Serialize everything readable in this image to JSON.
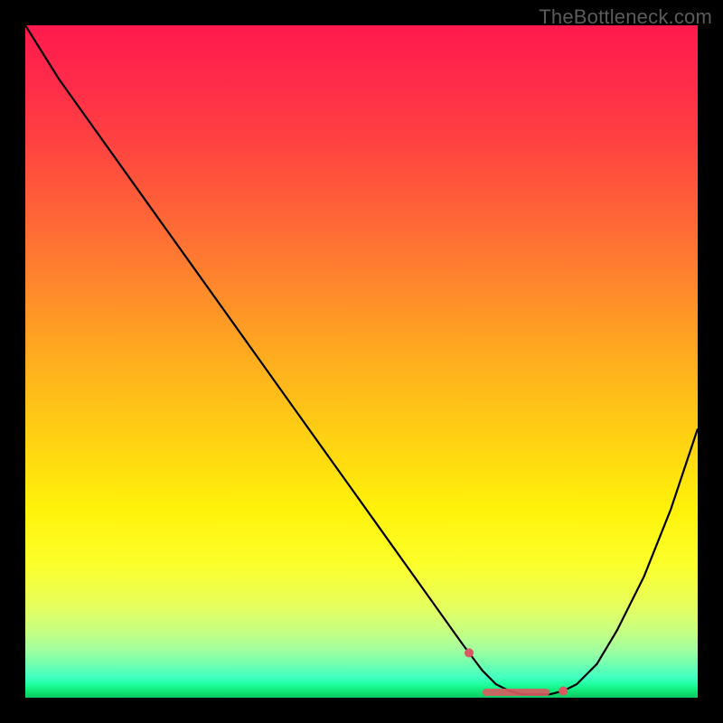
{
  "watermark": "TheBottleneck.com",
  "chart_data": {
    "type": "line",
    "x": [
      0.0,
      0.05,
      0.1,
      0.15,
      0.2,
      0.25,
      0.3,
      0.35,
      0.4,
      0.45,
      0.5,
      0.55,
      0.6,
      0.65,
      0.68,
      0.7,
      0.72,
      0.74,
      0.76,
      0.78,
      0.8,
      0.82,
      0.85,
      0.88,
      0.92,
      0.96,
      1.0
    ],
    "values": [
      100,
      92,
      85,
      78,
      71,
      64,
      57,
      50,
      43,
      36,
      29,
      22,
      15,
      8,
      4,
      2,
      1,
      0.5,
      0.5,
      0.5,
      1,
      2,
      5,
      10,
      18,
      28,
      40
    ],
    "xlabel": "",
    "ylabel": "",
    "ylim": [
      0,
      100
    ],
    "xlim": [
      0,
      1
    ],
    "title": "",
    "gradient": "green-to-red (bottom-to-top)",
    "markers_x": [
      0.66,
      0.8
    ],
    "flat_band_x": [
      0.68,
      0.78
    ]
  }
}
